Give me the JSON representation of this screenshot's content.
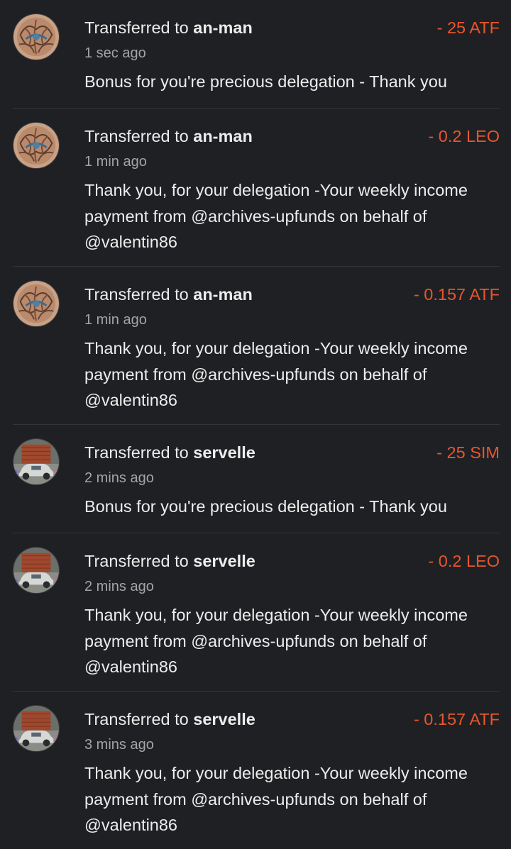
{
  "transfers": [
    {
      "prefix": "Transferred to",
      "user": "an-man",
      "amount": "- 25 ATF",
      "time": "1 sec ago",
      "memo": "Bonus for you're precious delegation - Thank you",
      "avatar": "pattern-avatar"
    },
    {
      "prefix": "Transferred to",
      "user": "an-man",
      "amount": "- 0.2 LEO",
      "time": "1 min ago",
      "memo": "Thank you, for your delegation -Your weekly income payment from @archives-upfunds on behalf of @valentin86",
      "avatar": "pattern-avatar"
    },
    {
      "prefix": "Transferred to",
      "user": "an-man",
      "amount": "- 0.157 ATF",
      "time": "1 min ago",
      "memo": "Thank you, for your delegation -Your weekly income payment from @archives-upfunds on behalf of @valentin86",
      "avatar": "pattern-avatar"
    },
    {
      "prefix": "Transferred to",
      "user": "servelle",
      "amount": "- 25 SIM",
      "time": "2 mins ago",
      "memo": "Bonus for you're precious delegation - Thank you",
      "avatar": "car-avatar"
    },
    {
      "prefix": "Transferred to",
      "user": "servelle",
      "amount": "- 0.2 LEO",
      "time": "2 mins ago",
      "memo": "Thank you, for your delegation -Your weekly income payment from @archives-upfunds on behalf of @valentin86",
      "avatar": "car-avatar"
    },
    {
      "prefix": "Transferred to",
      "user": "servelle",
      "amount": "- 0.157 ATF",
      "time": "3 mins ago",
      "memo": "Thank you, for your delegation -Your weekly income payment from @archives-upfunds on behalf of @valentin86",
      "avatar": "car-avatar"
    }
  ],
  "colors": {
    "background": "#1f2023",
    "amount": "#e8562d",
    "text": "#ededed",
    "muted": "#a3a4a8",
    "divider": "#34353a"
  }
}
